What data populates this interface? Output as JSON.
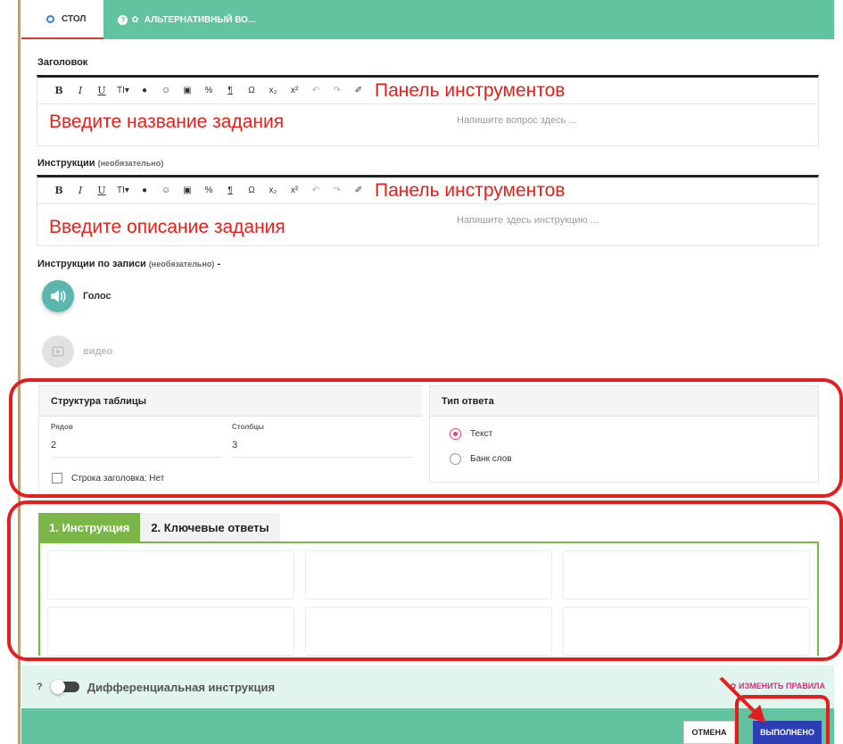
{
  "tabs": [
    {
      "label": "СТОЛ",
      "active": true
    },
    {
      "label": "АЛЬТЕРНАТИВНЫЙ ВО...",
      "active": false
    }
  ],
  "title_section": {
    "label": "Заголовок",
    "toolbar_annotation": "Панель инструментов",
    "annotation": "Введите название задания",
    "placeholder": "Напишите вопрос здесь ..."
  },
  "instructions_section": {
    "label": "Инструкции",
    "optional": "(необязательно)",
    "toolbar_annotation": "Панель инструментов",
    "annotation": "Введите описание задания",
    "placeholder": "Напишите здесь инструкцию ..."
  },
  "toolbar_buttons": [
    "B",
    "I",
    "U",
    "TI▾",
    "●",
    "☺",
    "▣",
    "%",
    "¶",
    "Ω",
    "x₂",
    "x²",
    "↶",
    "↷",
    "✐"
  ],
  "record_section": {
    "label": "Инструкции по записи",
    "optional": "(необязательно)",
    "suffix": "-",
    "voice_label": "Голос",
    "video_label": "видео"
  },
  "table_structure": {
    "title": "Структура таблицы",
    "rows_label": "Рядов",
    "rows_value": "2",
    "cols_label": "Столбцы",
    "cols_value": "3",
    "header_row_label": "Строка заголовка: Нет"
  },
  "answer_type": {
    "title": "Тип ответа",
    "options": [
      {
        "label": "Текст",
        "selected": true
      },
      {
        "label": "Банк слов",
        "selected": false
      }
    ]
  },
  "answer_tabs": [
    {
      "label": "1. Инструкция",
      "active": true
    },
    {
      "label": "2. Ключевые ответы",
      "active": false
    }
  ],
  "differentiation": {
    "help": "?",
    "label": "Дифференциальная инструкция",
    "change_rules": "ИЗМЕНИТЬ ПРАВИЛА"
  },
  "footer": {
    "cancel": "ОТМЕНА",
    "done": "ВЫПОЛНЕНО"
  },
  "colors": {
    "teal": "#62c49e",
    "annotation_red": "#e41e1e",
    "green_tab": "#7ab648",
    "done_button": "#2d3eb5"
  }
}
